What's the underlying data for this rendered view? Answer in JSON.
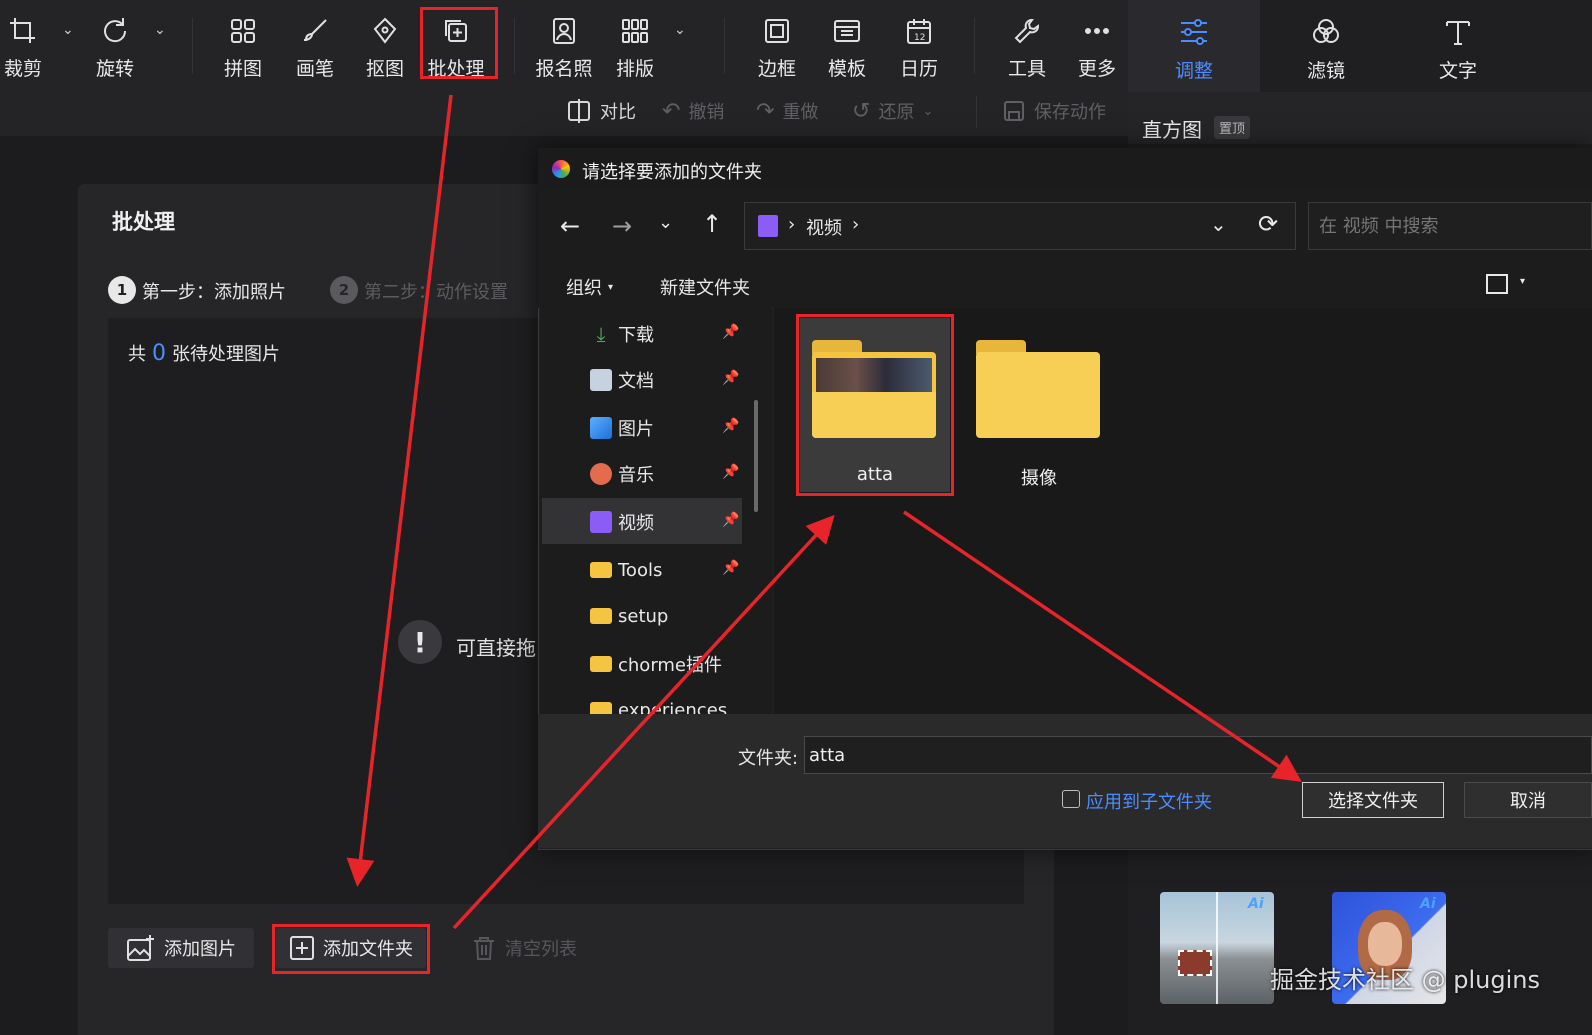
{
  "toolbar": {
    "items": [
      {
        "label": "裁剪",
        "icon": "crop-icon"
      },
      {
        "label": "旋转",
        "icon": "rotate-icon"
      },
      {
        "label": "拼图",
        "icon": "collage-icon"
      },
      {
        "label": "画笔",
        "icon": "brush-icon"
      },
      {
        "label": "抠图",
        "icon": "cutout-pen-icon"
      },
      {
        "label": "批处理",
        "icon": "batch-icon"
      },
      {
        "label": "报名照",
        "icon": "id-photo-icon"
      },
      {
        "label": "排版",
        "icon": "layout-grid-icon"
      },
      {
        "label": "边框",
        "icon": "frame-icon"
      },
      {
        "label": "模板",
        "icon": "template-icon"
      },
      {
        "label": "日历",
        "icon": "calendar-icon"
      },
      {
        "label": "工具",
        "icon": "wrench-icon"
      },
      {
        "label": "更多",
        "icon": "more-icon"
      }
    ],
    "sub": {
      "compare": "对比",
      "undo": "撤销",
      "redo": "重做",
      "restore": "还原",
      "save_action": "保存动作"
    }
  },
  "right_panel": {
    "tabs": [
      {
        "label": "调整",
        "icon": "adjust-sliders-icon",
        "active": true
      },
      {
        "label": "滤镜",
        "icon": "filter-icon",
        "active": false
      },
      {
        "label": "文字",
        "icon": "text-icon",
        "active": false
      }
    ],
    "histogram_title": "直方图",
    "pin_top": "置顶"
  },
  "batch": {
    "title": "批处理",
    "step1_num": "1",
    "step1": "第一步：添加照片",
    "step2_num": "2",
    "step2": "第二步：动作设置",
    "count_prefix": "共",
    "count": "0",
    "count_suffix": "张待处理图片",
    "hint": "可直接拖",
    "add_image": "添加图片",
    "add_folder": "添加文件夹",
    "clear_list": "清空列表"
  },
  "dialog": {
    "title": "请选择要添加的文件夹",
    "breadcrumb": "视频",
    "search_placeholder": "在 视频 中搜索",
    "organize": "组织",
    "new_folder": "新建文件夹",
    "nav_items": [
      {
        "label": "下载",
        "icon": "download-icon",
        "pinned": true
      },
      {
        "label": "文档",
        "icon": "documents-icon",
        "pinned": true
      },
      {
        "label": "图片",
        "icon": "pictures-icon",
        "pinned": true
      },
      {
        "label": "音乐",
        "icon": "music-icon",
        "pinned": true
      },
      {
        "label": "视频",
        "icon": "videos-icon",
        "pinned": true,
        "selected": true
      },
      {
        "label": "Tools",
        "icon": "folder-icon",
        "pinned": true
      },
      {
        "label": "setup",
        "icon": "folder-icon",
        "pinned": false
      },
      {
        "label": "chorme插件",
        "icon": "folder-icon",
        "pinned": false
      },
      {
        "label": "experiences",
        "icon": "folder-icon",
        "pinned": false
      }
    ],
    "files": [
      {
        "name": "atta",
        "thumbnail": true,
        "selected": true
      },
      {
        "name": "摄像",
        "thumbnail": false,
        "selected": false
      }
    ],
    "folder_label": "文件夹:",
    "folder_value": "atta",
    "apply_sub": "应用到子文件夹",
    "select_button": "选择文件夹",
    "cancel_button": "取消"
  },
  "watermark": "掘金技术社区 @ plugins",
  "colors": {
    "accent": "#4b8cff",
    "annotation": "#e8242b",
    "folder": "#f5c542"
  }
}
